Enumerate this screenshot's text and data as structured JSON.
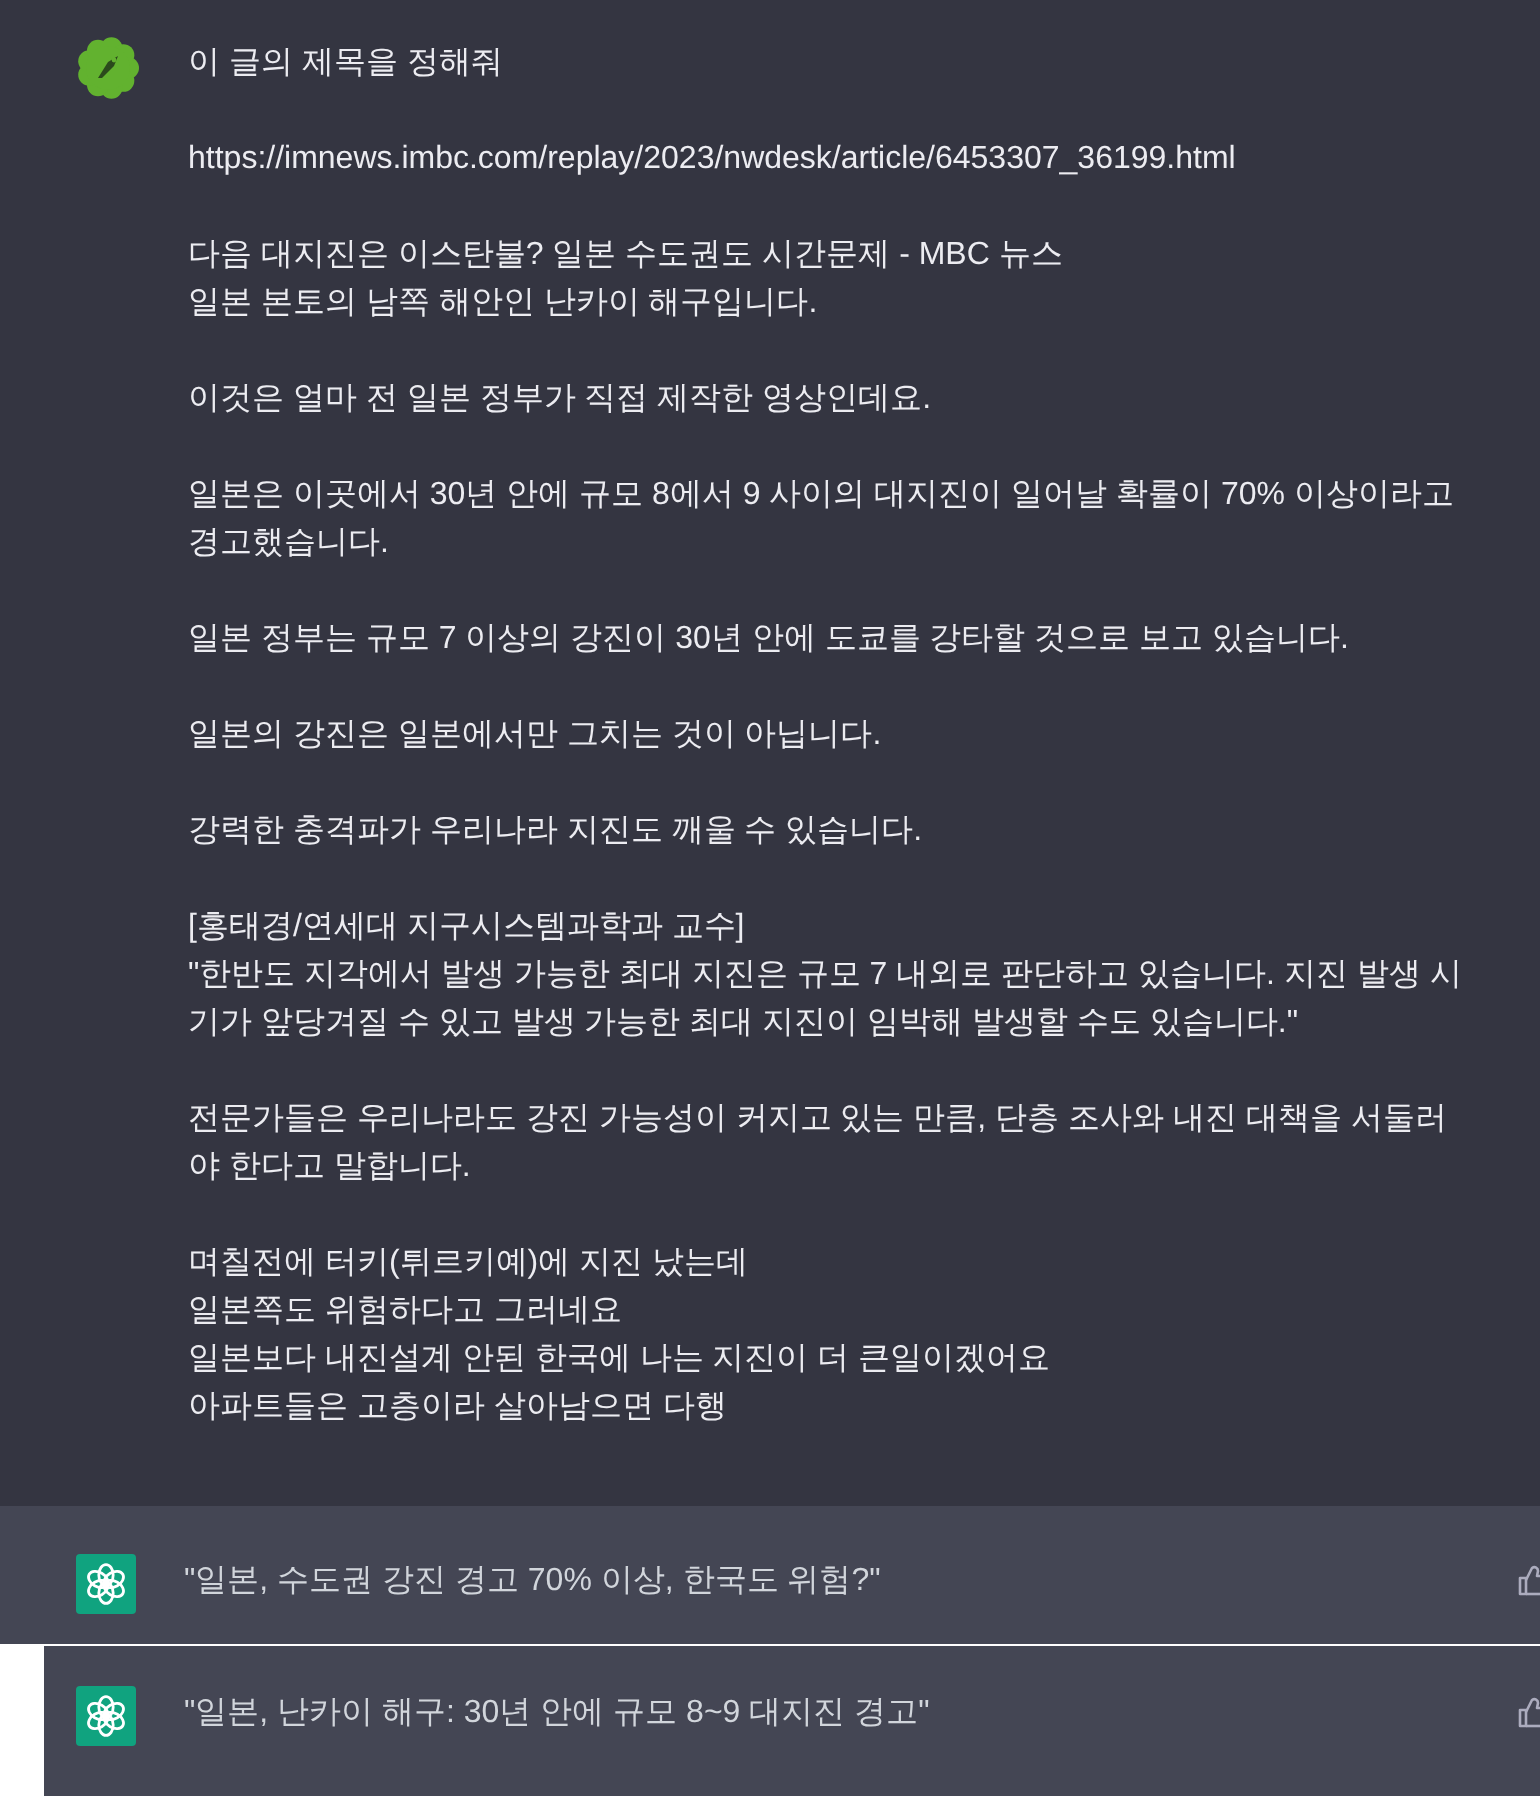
{
  "user_message": {
    "paragraphs": [
      "이 글의 제목을 정해줘",
      "https://imnews.imbc.com/replay/2023/nwdesk/article/6453307_36199.html",
      "다음 대지진은 이스탄불? 일본 수도권도 시간문제 - MBC 뉴스\n일본 본토의 남쪽 해안인 난카이 해구입니다.",
      "이것은 얼마 전 일본 정부가 직접 제작한 영상인데요.",
      "일본은 이곳에서 30년 안에 규모 8에서 9 사이의 대지진이 일어날 확률이 70% 이상이라고 경고했습니다.",
      "일본 정부는 규모 7 이상의 강진이 30년 안에 도쿄를 강타할 것으로 보고 있습니다.",
      "일본의 강진은 일본에서만 그치는 것이 아닙니다.",
      "강력한 충격파가 우리나라 지진도 깨울 수 있습니다.",
      "[홍태경/연세대 지구시스템과학과 교수]\n\"한반도 지각에서 발생 가능한 최대 지진은 규모 7 내외로 판단하고 있습니다. 지진 발생 시기가 앞당겨질 수 있고 발생 가능한 최대 지진이 임박해 발생할 수도 있습니다.\"",
      "전문가들은 우리나라도 강진 가능성이 커지고 있는 만큼, 단층 조사와 내진 대책을 서둘러야 한다고 말합니다.",
      "며칠전에 터키(튀르키예)에 지진 났는데\n일본쪽도 위험하다고 그러네요\n일본보다 내진설계 안된 한국에 나는 지진이 더 큰일이겠어요\n아파트들은 고층이라 살아남으면 다행"
    ]
  },
  "responses": [
    {
      "text": "\"일본, 수도권 강진 경고 70% 이상, 한국도 위험?\""
    },
    {
      "text": "\"일본, 난카이 해구: 30년 안에 규모 8~9 대지진 경고\""
    }
  ]
}
